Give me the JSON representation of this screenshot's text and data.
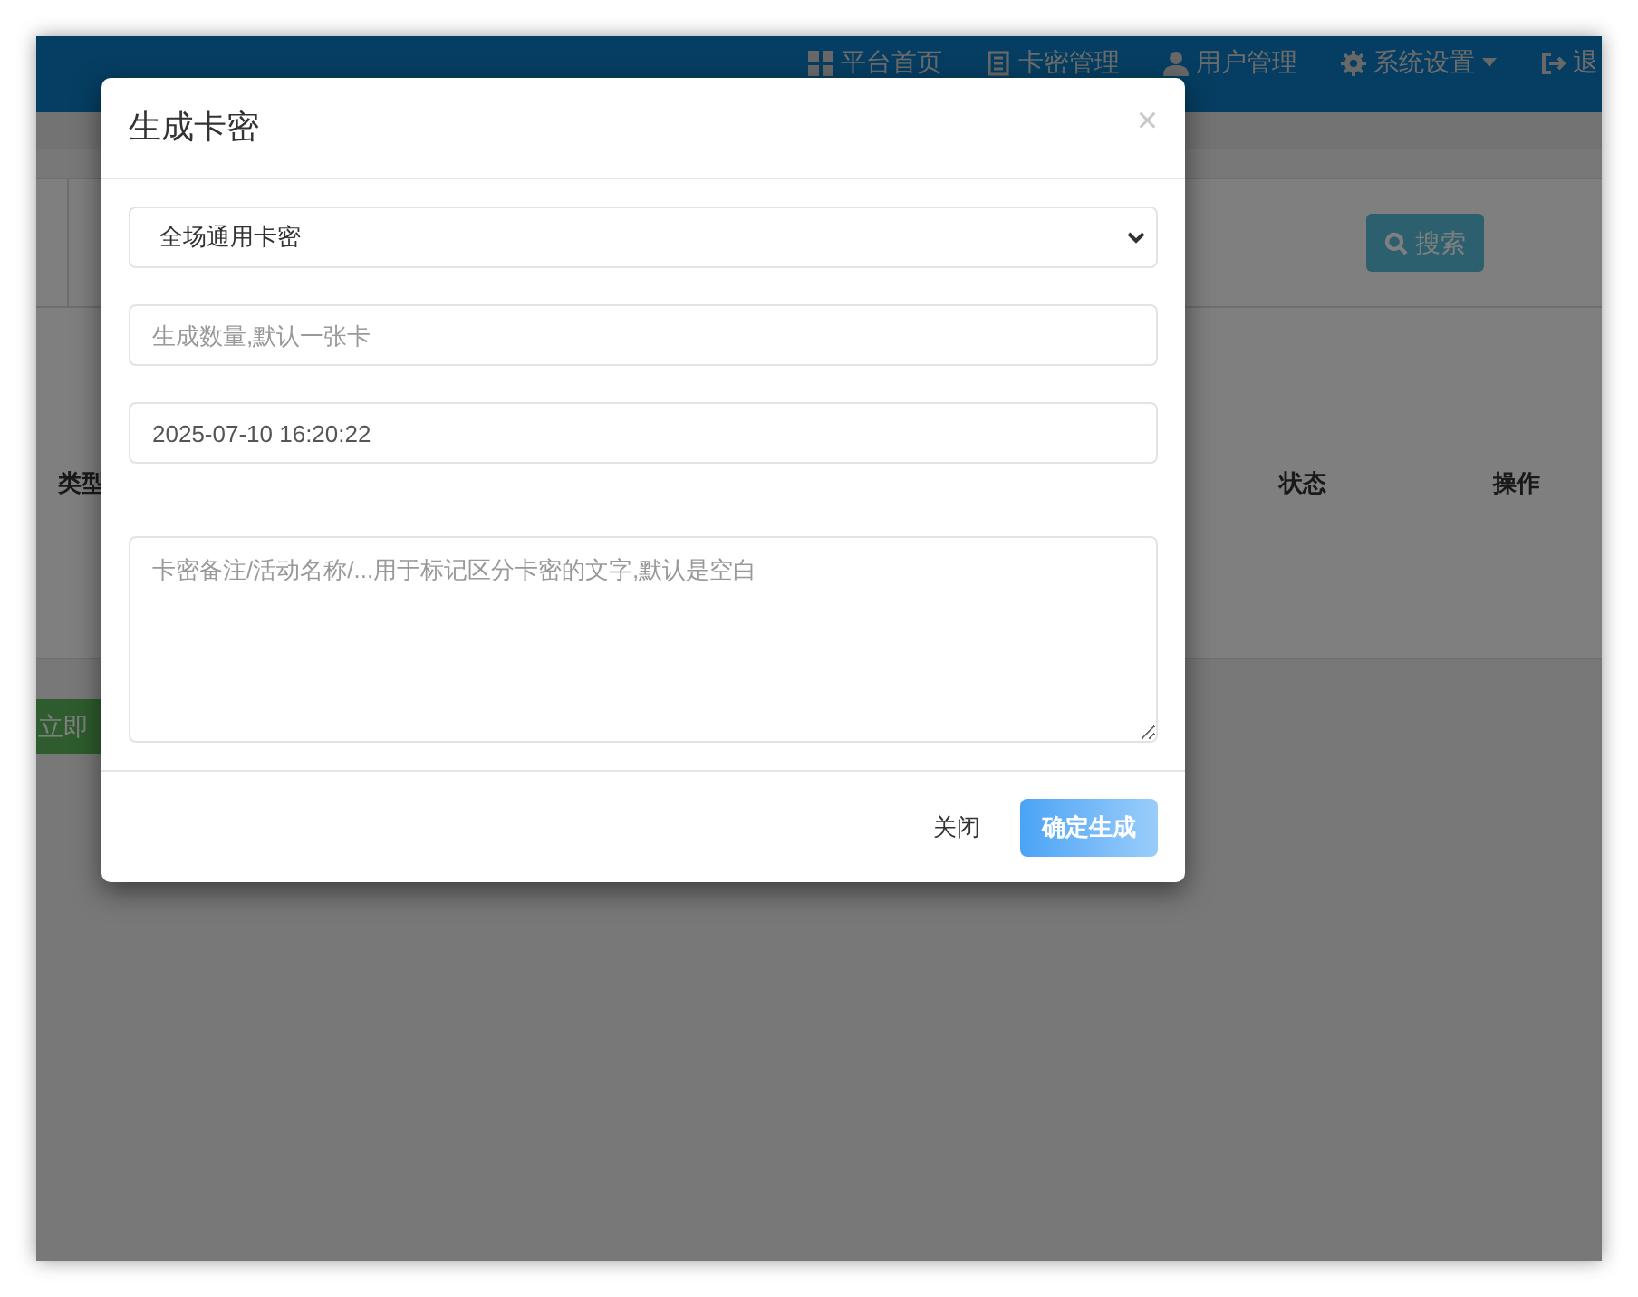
{
  "navbar": {
    "items": [
      {
        "kind": "grid",
        "label": "平台首页"
      },
      {
        "kind": "book",
        "label": "卡密管理"
      },
      {
        "kind": "user",
        "label": "用户管理"
      },
      {
        "kind": "gear",
        "label": "系统设置",
        "dropdown": true
      },
      {
        "kind": "logout",
        "label": "退"
      }
    ]
  },
  "search_button": {
    "label": "搜索"
  },
  "table": {
    "columns": [
      {
        "label": "类型"
      },
      {
        "label": "状态"
      },
      {
        "label": "操作"
      }
    ]
  },
  "run_button": {
    "label": "立即"
  },
  "modal": {
    "title": "生成卡密",
    "close": "×",
    "type_select": {
      "value": "全场通用卡密"
    },
    "count_field": {
      "placeholder": "生成数量,默认一张卡"
    },
    "expiry_field": {
      "value": "2025-07-10 16:20:22"
    },
    "note_field": {
      "placeholder": "卡密备注/活动名称/...用于标记区分卡密的文字,默认是空白"
    },
    "buttons": [
      {
        "kind": "plain",
        "label": "关闭"
      },
      {
        "kind": "primary",
        "label": "确定生成"
      }
    ]
  }
}
